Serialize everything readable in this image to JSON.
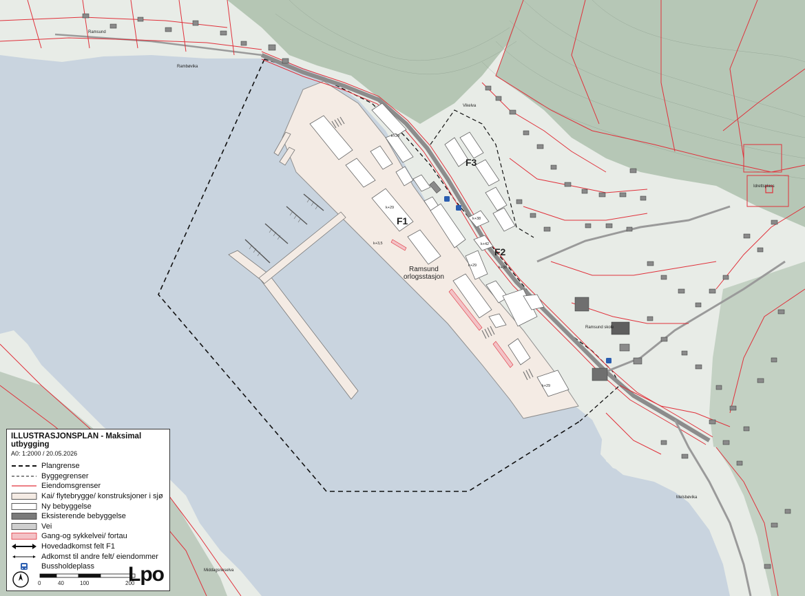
{
  "map": {
    "place_labels": {
      "ramsund_nw": "Ramsund",
      "rambovika": "Rambøvika",
      "vikelva": "Vikelva",
      "idrettsplass": "Idrettsplass",
      "ramsund_skole": "Ramsund skole",
      "melsbovika": "Melsbøvika",
      "middagsneselva": "Middagsneselva",
      "station": [
        "Ramsund",
        "orlogsstasjon"
      ]
    },
    "field_labels": {
      "f1": "F1",
      "f2": "F2",
      "f3": "F3"
    },
    "height_labels": [
      "k+29",
      "k+29",
      "k+3,5",
      "k+29",
      "k+29",
      "k+38",
      "k+42",
      "k+38"
    ],
    "colors": {
      "sea": "#c9d4df",
      "land": "#e6ebe6",
      "forest": "#9bb39c",
      "quay": "#f4ebe4",
      "property_line": "#e0303a",
      "building_new": "#ffffff",
      "building_existing": "#8a8a8a",
      "bus_stop": "#2a5db0"
    }
  },
  "legend": {
    "title": "ILLUSTRASJONSPLAN - Maksimal utbygging",
    "subtitle": "A0: 1:2000 / 20.05.2026",
    "items": [
      {
        "label": "Plangrense",
        "symbol": "dashed-thick"
      },
      {
        "label": "Byggegrenser",
        "symbol": "dashed-thin"
      },
      {
        "label": "Eiendomsgrenser",
        "symbol": "red-line"
      },
      {
        "label": "Kai/ flytebrygge/ konstruksjoner i sjø",
        "symbol": "quay-box"
      },
      {
        "label": "Ny bebyggelse",
        "symbol": "white-box"
      },
      {
        "label": "Eksisterende bebyggelse",
        "symbol": "grey-box"
      },
      {
        "label": "Vei",
        "symbol": "light-grey-box"
      },
      {
        "label": "Gang-og sykkelvei/ fortau",
        "symbol": "pink-box"
      },
      {
        "label": "Hovedadkomst felt F1",
        "symbol": "double-arrow-thick"
      },
      {
        "label": "Adkomst til andre felt/ eiendommer",
        "symbol": "double-arrow-thin"
      },
      {
        "label": "Bussholdeplass",
        "symbol": "bus-icon"
      }
    ],
    "scale_ticks": [
      "0",
      "40",
      "100",
      "200"
    ],
    "logo": "Lpo"
  }
}
